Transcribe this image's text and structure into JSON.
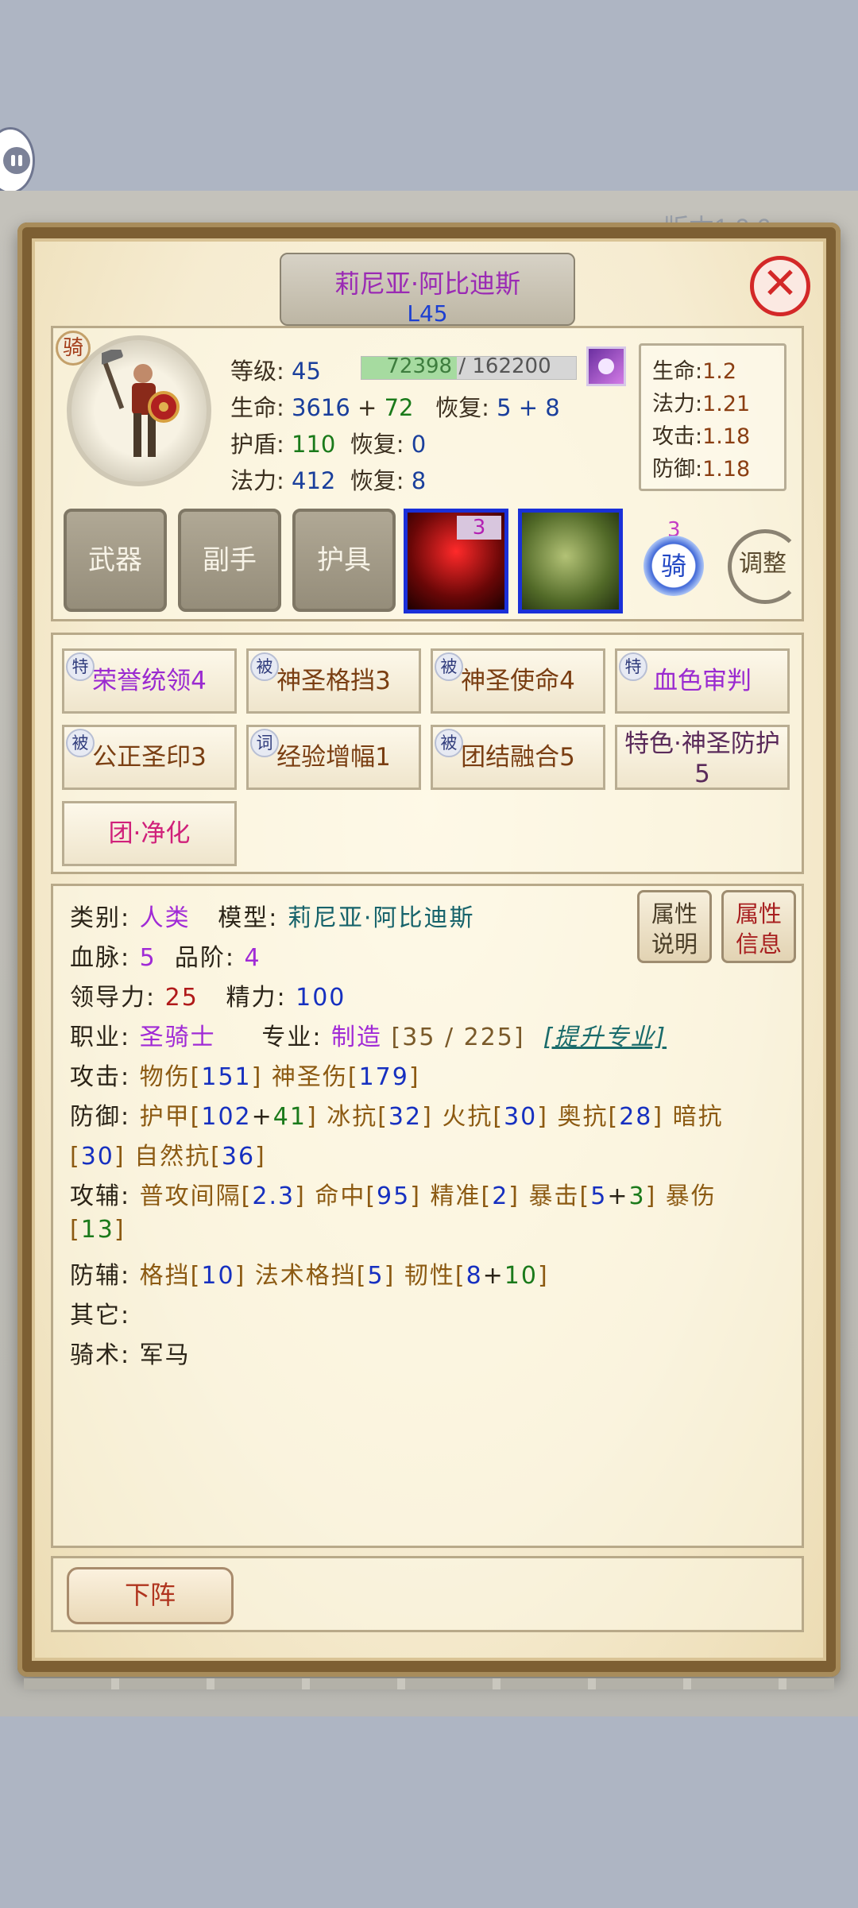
{
  "version_text": "版本1.0.6",
  "hero": {
    "name": "莉尼亚·阿比迪斯",
    "level_tag": "L45",
    "ride_tag": "骑"
  },
  "stats": {
    "level_label": "等级:",
    "level_value": "45",
    "xp_current": "72398",
    "xp_sep": " / ",
    "xp_max": "162200",
    "xp_fraction": 0.446,
    "hp_label": "生命:",
    "hp_base": "3616",
    "hp_plus": "+",
    "hp_bonus": "72",
    "hp_regen_label": "恢复:",
    "hp_regen": "5 + 8",
    "shield_label": "护盾:",
    "shield_value": "110",
    "shield_regen_label": "恢复:",
    "shield_regen": "0",
    "mana_label": "法力:",
    "mana_value": "412",
    "mana_regen_label": "恢复:",
    "mana_regen": "8"
  },
  "growth": [
    {
      "label": "生命:",
      "value": "1.2"
    },
    {
      "label": "法力:",
      "value": "1.21"
    },
    {
      "label": "攻击:",
      "value": "1.18"
    },
    {
      "label": "防御:",
      "value": "1.18"
    }
  ],
  "equipment": {
    "weapon": "武器",
    "offhand": "副手",
    "armor": "护具",
    "item1_count": "3",
    "ride_badge_count": "3",
    "ride_badge_label": "骑",
    "adjust": "调整"
  },
  "skills": [
    {
      "tag": "特",
      "name": "荣誉统领4"
    },
    {
      "tag": "被",
      "name": "神圣格挡3"
    },
    {
      "tag": "被",
      "name": "神圣使命4"
    },
    {
      "tag": "特",
      "name": "血色审判"
    },
    {
      "tag": "被",
      "name": "公正圣印3"
    },
    {
      "tag": "词",
      "name": "经验增幅1"
    },
    {
      "tag": "被",
      "name": "团结融合5"
    },
    {
      "tag": "",
      "name": "特色·神圣防护",
      "name2": "5"
    },
    {
      "tag": "",
      "name": "团·净化"
    }
  ],
  "attributes": {
    "type_label": "类别:",
    "type_value": "人类",
    "model_label": "模型:",
    "model_value": "莉尼亚·阿比迪斯",
    "bloodline_label": "血脉:",
    "bloodline_value": "5",
    "grade_label": "品阶:",
    "grade_value": "4",
    "leadership_label": "领导力:",
    "leadership_value": "25",
    "energy_label": "精力:",
    "energy_value": "100",
    "job_label": "职业:",
    "job_value": "圣骑士",
    "profession_label": "专业:",
    "profession_value": "制造",
    "profession_progress": "[35 / 225]",
    "upgrade_link": "[提升专业]",
    "attack_label": "攻击:",
    "phys_label": "物伤[",
    "phys_value": "151",
    "holy_label": "] 神圣伤[",
    "holy_value": "179",
    "close_bracket": "]",
    "defense_label": "防御:",
    "armor_label": "护甲[",
    "armor_base": "102",
    "armor_plus": "+",
    "armor_bonus": "41",
    "ice_label": "] 冰抗[",
    "ice_value": "32",
    "fire_label": "] 火抗[",
    "fire_value": "30",
    "arcane_label": "] 奥抗[",
    "arcane_value": "28",
    "dark_label": "] 暗抗",
    "dark_value": "30",
    "nature_label": "] 自然抗[",
    "nature_value": "36",
    "atkaux_label": "攻辅:",
    "interval_label": "普攻间隔[",
    "interval_value": "2.3",
    "hit_label": "] 命中[",
    "hit_value": "95",
    "precision_label": "] 精准[",
    "precision_value": "2",
    "crit_label": "] 暴击[",
    "crit_base": "5",
    "crit_plus": "+",
    "crit_bonus": "3",
    "critdmg_label": "] 暴伤",
    "critdmg_value": "13",
    "defaux_label": "防辅:",
    "block_label": "格挡[",
    "block_value": "10",
    "spellblock_label": "] 法术格挡[",
    "spellblock_value": "5",
    "tough_label": "] 韧性[",
    "tough_base": "8",
    "tough_plus": "+",
    "tough_bonus": "10",
    "other_label": "其它:",
    "riding_label": "骑术:",
    "riding_value": "军马",
    "open_bracket": "["
  },
  "buttons": {
    "attr_desc_1": "属性",
    "attr_desc_2": "说明",
    "attr_info_1": "属性",
    "attr_info_2": "信息",
    "unequip": "下阵",
    "close": "✕"
  }
}
